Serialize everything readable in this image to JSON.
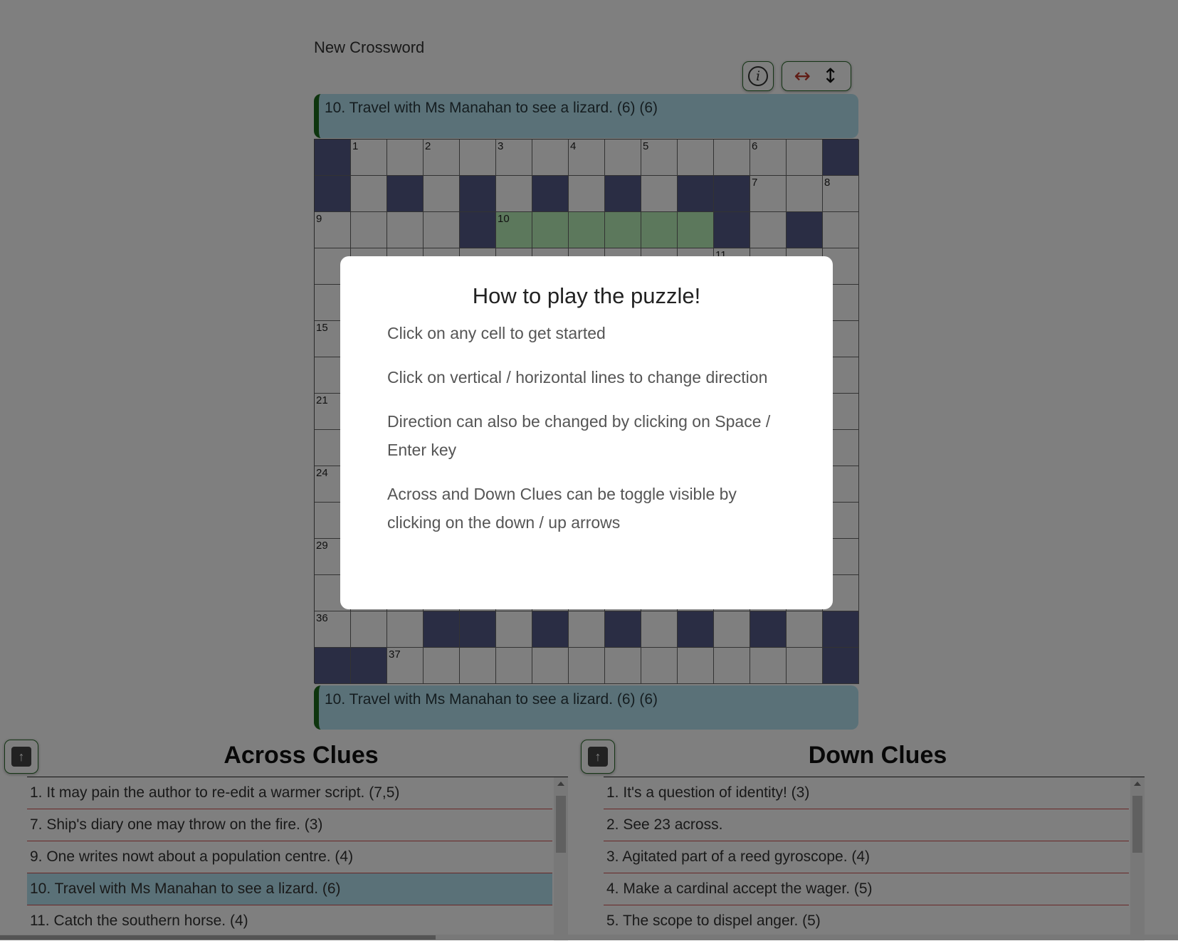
{
  "app": {
    "title": "New Crossword"
  },
  "toolbar": {
    "info_icon": "info-icon",
    "info_glyph": "i",
    "horizontal_glyph": "↔",
    "vertical_glyph": "↕"
  },
  "current_clue": {
    "text": "10. Travel with Ms Manahan to see a lizard. (6) (6)"
  },
  "colors": {
    "block": "#545b89",
    "highlight": "#b9f1b9",
    "clue_bg": "#b5e3f0",
    "accent_green": "#1d6b1d",
    "divider_red": "#d05050"
  },
  "grid": {
    "size": 15,
    "rows": [
      "#.............#",
      "#.#.#.#.#.##...",
      "....#......#.#.",
      "...............",
      "...............",
      "...............",
      "...............",
      "...............",
      "...............",
      "...............",
      "...............",
      "...............",
      "...............",
      "...##.#.#.#.#.#",
      "##............#"
    ],
    "numbers": [
      {
        "r": 0,
        "c": 1,
        "n": "1"
      },
      {
        "r": 0,
        "c": 3,
        "n": "2"
      },
      {
        "r": 0,
        "c": 5,
        "n": "3"
      },
      {
        "r": 0,
        "c": 7,
        "n": "4"
      },
      {
        "r": 0,
        "c": 9,
        "n": "5"
      },
      {
        "r": 0,
        "c": 12,
        "n": "6"
      },
      {
        "r": 1,
        "c": 12,
        "n": "7"
      },
      {
        "r": 1,
        "c": 14,
        "n": "8"
      },
      {
        "r": 2,
        "c": 0,
        "n": "9"
      },
      {
        "r": 2,
        "c": 5,
        "n": "10"
      },
      {
        "r": 3,
        "c": 11,
        "n": "11"
      },
      {
        "r": 5,
        "c": 0,
        "n": "15"
      },
      {
        "r": 7,
        "c": 0,
        "n": "21"
      },
      {
        "r": 9,
        "c": 0,
        "n": "24"
      },
      {
        "r": 11,
        "c": 0,
        "n": "29"
      },
      {
        "r": 13,
        "c": 0,
        "n": "36"
      },
      {
        "r": 14,
        "c": 2,
        "n": "37"
      }
    ],
    "highlighted": [
      {
        "r": 2,
        "c": 5
      },
      {
        "r": 2,
        "c": 6
      },
      {
        "r": 2,
        "c": 7
      },
      {
        "r": 2,
        "c": 8
      },
      {
        "r": 2,
        "c": 9
      },
      {
        "r": 2,
        "c": 10
      }
    ]
  },
  "across": {
    "heading": "Across Clues",
    "toggle_icon": "arrow-up-icon",
    "toggle_glyph": "↑",
    "items": [
      {
        "text": "1. It may pain the author to re-edit a warmer script. (7,5)",
        "active": false
      },
      {
        "text": "7. Ship's diary one may throw on the fire. (3)",
        "active": false
      },
      {
        "text": "9. One writes nowt about a population centre. (4)",
        "active": false
      },
      {
        "text": "10. Travel with Ms Manahan to see a lizard. (6)",
        "active": true
      },
      {
        "text": "11. Catch the southern horse. (4)",
        "active": false
      }
    ]
  },
  "down": {
    "heading": "Down Clues",
    "toggle_icon": "arrow-up-icon",
    "toggle_glyph": "↑",
    "items": [
      {
        "text": "1. It's a question of identity! (3)",
        "active": false
      },
      {
        "text": "2. See 23 across.",
        "active": false
      },
      {
        "text": "3. Agitated part of a reed gyroscope. (4)",
        "active": false
      },
      {
        "text": "4. Make a cardinal accept the wager. (5)",
        "active": false
      },
      {
        "text": "5. The scope to dispel anger. (5)",
        "active": false
      }
    ]
  },
  "modal": {
    "title": "How to play the puzzle!",
    "lines": [
      "Click on any cell to get started",
      "Click on vertical / horizontal lines to change direction",
      "Direction can also be changed by clicking on Space / Enter key",
      "Across and Down Clues can be toggle visible by clicking on the down / up arrows"
    ]
  }
}
